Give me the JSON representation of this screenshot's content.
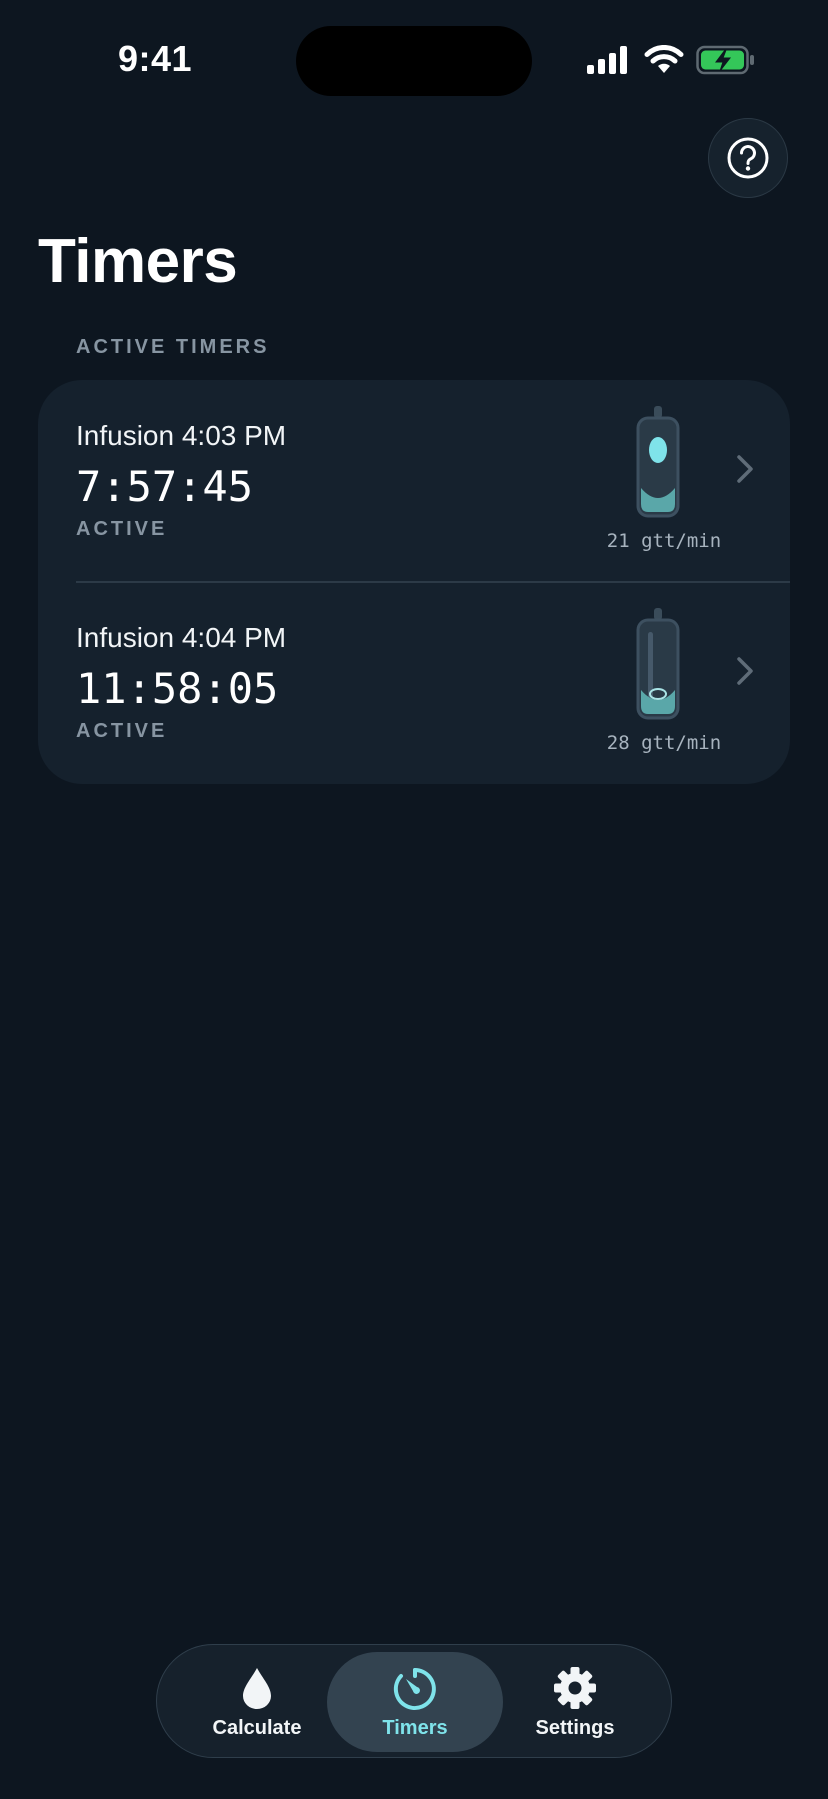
{
  "status_bar": {
    "time": "9:41",
    "icons": [
      "signal-icon",
      "wifi-icon",
      "battery-charging-icon"
    ]
  },
  "header": {
    "title": "Timers",
    "help_icon": "question-circle-icon"
  },
  "section": {
    "label": "ACTIVE TIMERS"
  },
  "timers": [
    {
      "title": "Infusion 4:03 PM",
      "remaining": "7:57:45",
      "status": "ACTIVE",
      "rate": "21 gtt/min",
      "icon": "drip-chamber-icon"
    },
    {
      "title": "Infusion 4:04 PM",
      "remaining": "11:58:05",
      "status": "ACTIVE",
      "rate": "28 gtt/min",
      "icon": "drip-chamber-icon"
    }
  ],
  "tabbar": {
    "tabs": [
      {
        "label": "Calculate",
        "icon": "drop-icon",
        "selected": false
      },
      {
        "label": "Timers",
        "icon": "timer-icon",
        "selected": true
      },
      {
        "label": "Settings",
        "icon": "gear-icon",
        "selected": false
      }
    ]
  },
  "colors": {
    "background": "#0d1620",
    "card": "#15212d",
    "accent": "#7fe3ea",
    "muted_text": "#8795a2",
    "battery_green": "#34c759"
  }
}
